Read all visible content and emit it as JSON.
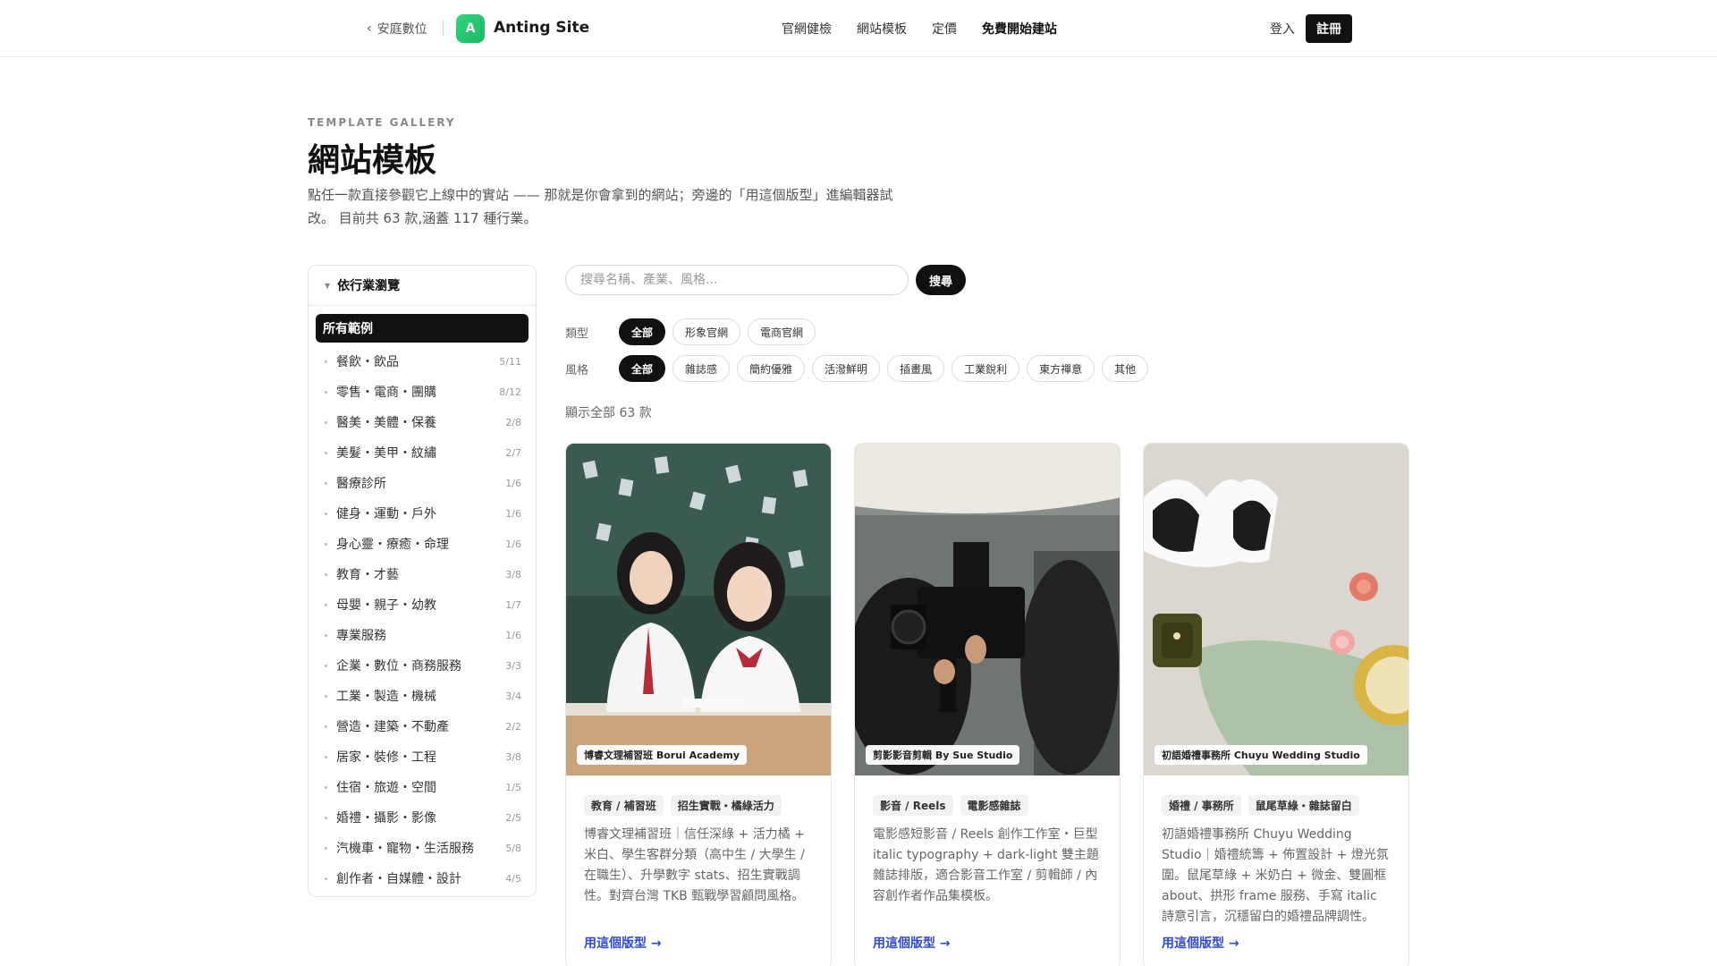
{
  "header": {
    "back_label": "安庭數位",
    "logo_letter": "A",
    "brand": "Anting Site",
    "nav": [
      {
        "label": "官網健檢",
        "strong": false
      },
      {
        "label": "網站模板",
        "strong": false
      },
      {
        "label": "定價",
        "strong": false
      },
      {
        "label": "免費開始建站",
        "strong": true
      }
    ],
    "login": "登入",
    "register": "註冊"
  },
  "hero": {
    "eyebrow": "TEMPLATE GALLERY",
    "title": "網站模板",
    "description": "點任一款直接參觀它上線中的實站 —— 那就是你會拿到的網站；旁邊的「用這個版型」進編輯器試改。 目前共 63 款,涵蓋 117 種行業。"
  },
  "sidebar": {
    "heading": "依行業瀏覽",
    "all_label": "所有範例",
    "items": [
      {
        "label": "餐飲・飲品",
        "count": "5/11"
      },
      {
        "label": "零售・電商・團購",
        "count": "8/12"
      },
      {
        "label": "醫美・美體・保養",
        "count": "2/8"
      },
      {
        "label": "美髮・美甲・紋繡",
        "count": "2/7"
      },
      {
        "label": "醫療診所",
        "count": "1/6"
      },
      {
        "label": "健身・運動・戶外",
        "count": "1/6"
      },
      {
        "label": "身心靈・療癒・命理",
        "count": "1/6"
      },
      {
        "label": "教育・才藝",
        "count": "3/8"
      },
      {
        "label": "母嬰・親子・幼教",
        "count": "1/7"
      },
      {
        "label": "專業服務",
        "count": "1/6"
      },
      {
        "label": "企業・數位・商務服務",
        "count": "3/3"
      },
      {
        "label": "工業・製造・機械",
        "count": "3/4"
      },
      {
        "label": "營造・建築・不動產",
        "count": "2/2"
      },
      {
        "label": "居家・裝修・工程",
        "count": "3/8"
      },
      {
        "label": "住宿・旅遊・空間",
        "count": "1/5"
      },
      {
        "label": "婚禮・攝影・影像",
        "count": "2/5"
      },
      {
        "label": "汽機車・寵物・生活服務",
        "count": "5/8"
      },
      {
        "label": "創作者・自媒體・設計",
        "count": "4/5"
      }
    ]
  },
  "search": {
    "placeholder": "搜尋名稱、產業、風格...",
    "button": "搜尋"
  },
  "filters": {
    "type": {
      "label": "類型",
      "chips": [
        "全部",
        "形象官網",
        "電商官網"
      ],
      "active": 0
    },
    "style": {
      "label": "風格",
      "chips": [
        "全部",
        "雜誌感",
        "簡約優雅",
        "活潑鮮明",
        "插畫風",
        "工業銳利",
        "東方禪意",
        "其他"
      ],
      "active": 0
    }
  },
  "result_count": "顯示全部 63 款",
  "cards": [
    {
      "caption": "博睿文理補習班 Borui Academy",
      "tags": [
        "教育 / 補習班",
        "招生實戰・橘綠活力"
      ],
      "description": "博睿文理補習班｜信任深綠 + 活力橘 + 米白、學生客群分類（高中生 / 大學生 / 在職生）、升學數字 stats、招生實戰調性。對齊台灣 TKB 甄戰學習顧問風格。",
      "cta": "用這個版型 →"
    },
    {
      "caption": "剪影影音剪輯 By Sue Studio",
      "tags": [
        "影音 / Reels",
        "電影感雜誌"
      ],
      "description": "電影感短影音 / Reels 創作工作室・巨型 italic typography + dark-light 雙主題雜誌排版，適合影音工作室 / 剪輯師 / 內容創作者作品集模板。",
      "cta": "用這個版型 →"
    },
    {
      "caption": "初語婚禮事務所 Chuyu Wedding Studio",
      "tags": [
        "婚禮 / 事務所",
        "鼠尾草綠・雜誌留白"
      ],
      "description": "初語婚禮事務所 Chuyu Wedding Studio｜婚禮統籌 + 佈置設計 + 燈光氛圍。鼠尾草綠 + 米奶白 + 微金、雙圓框 about、拱形 frame 服務、手寫 italic 詩意引言，沉穩留白的婚禮品牌調性。",
      "cta": "用這個版型 →"
    }
  ]
}
